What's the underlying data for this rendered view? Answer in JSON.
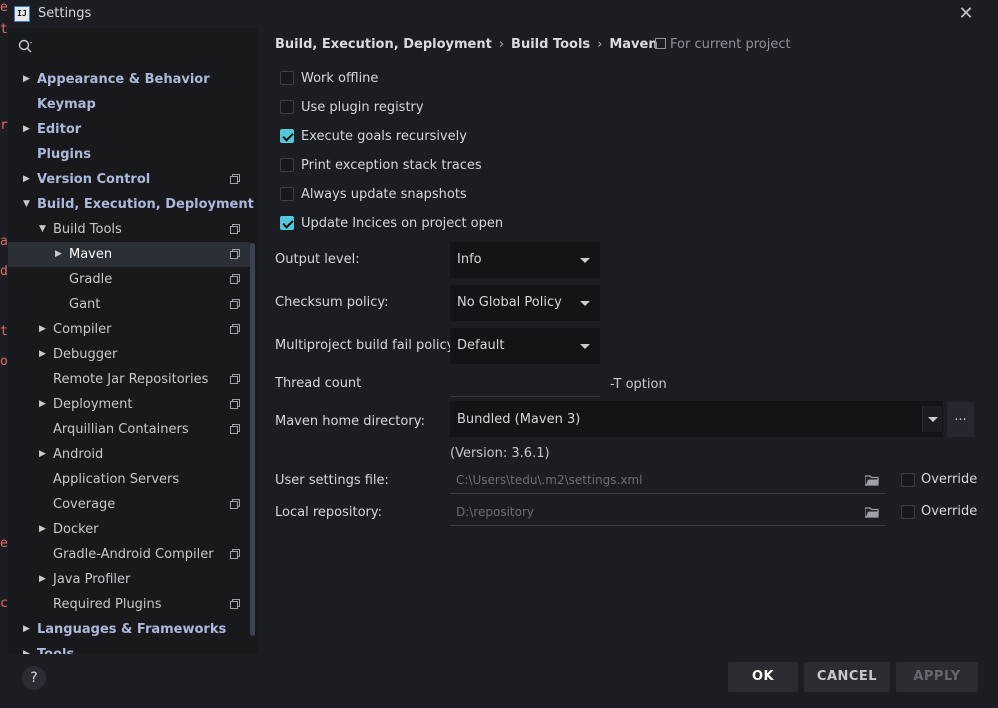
{
  "window": {
    "title": "Settings",
    "logo": "IJ"
  },
  "editor_edge": [
    "e",
    "t",
    "r",
    "a",
    "d",
    "t",
    "o",
    "e",
    "c"
  ],
  "sidebar": {
    "search_placeholder": "",
    "items": [
      {
        "label": "Appearance & Behavior",
        "level": 0,
        "expand": "collapsed",
        "project": false
      },
      {
        "label": "Keymap",
        "level": 0,
        "expand": "none",
        "project": false
      },
      {
        "label": "Editor",
        "level": 0,
        "expand": "collapsed",
        "project": false
      },
      {
        "label": "Plugins",
        "level": 0,
        "expand": "none",
        "project": false
      },
      {
        "label": "Version Control",
        "level": 0,
        "expand": "collapsed",
        "project": true
      },
      {
        "label": "Build, Execution, Deployment",
        "level": 0,
        "expand": "expanded",
        "project": false
      },
      {
        "label": "Build Tools",
        "level": 1,
        "expand": "expanded",
        "project": true
      },
      {
        "label": "Maven",
        "level": 2,
        "expand": "collapsed",
        "project": true,
        "selected": true
      },
      {
        "label": "Gradle",
        "level": 2,
        "expand": "none",
        "project": true
      },
      {
        "label": "Gant",
        "level": 2,
        "expand": "none",
        "project": true
      },
      {
        "label": "Compiler",
        "level": 1,
        "expand": "collapsed",
        "project": true
      },
      {
        "label": "Debugger",
        "level": 1,
        "expand": "collapsed",
        "project": false
      },
      {
        "label": "Remote Jar Repositories",
        "level": 1,
        "expand": "none",
        "project": true
      },
      {
        "label": "Deployment",
        "level": 1,
        "expand": "collapsed",
        "project": true
      },
      {
        "label": "Arquillian Containers",
        "level": 1,
        "expand": "none",
        "project": true
      },
      {
        "label": "Android",
        "level": 1,
        "expand": "collapsed",
        "project": false
      },
      {
        "label": "Application Servers",
        "level": 1,
        "expand": "none",
        "project": false
      },
      {
        "label": "Coverage",
        "level": 1,
        "expand": "none",
        "project": true
      },
      {
        "label": "Docker",
        "level": 1,
        "expand": "collapsed",
        "project": false
      },
      {
        "label": "Gradle-Android Compiler",
        "level": 1,
        "expand": "none",
        "project": true
      },
      {
        "label": "Java Profiler",
        "level": 1,
        "expand": "collapsed",
        "project": false
      },
      {
        "label": "Required Plugins",
        "level": 1,
        "expand": "none",
        "project": true
      },
      {
        "label": "Languages & Frameworks",
        "level": 0,
        "expand": "collapsed",
        "project": false
      },
      {
        "label": "Tools",
        "level": 0,
        "expand": "collapsed",
        "project": false
      }
    ]
  },
  "breadcrumb": {
    "items": [
      "Build, Execution, Deployment",
      "Build Tools",
      "Maven"
    ],
    "separator": "›"
  },
  "scope_note": "For current project",
  "checkboxes": [
    {
      "label": "Work offline",
      "checked": false
    },
    {
      "label": "Use plugin registry",
      "checked": false
    },
    {
      "label": "Execute goals recursively",
      "checked": true
    },
    {
      "label": "Print exception stack traces",
      "checked": false
    },
    {
      "label": "Always update snapshots",
      "checked": false
    },
    {
      "label": "Update Incices on project open",
      "checked": true
    }
  ],
  "output_level": {
    "label": "Output level:",
    "value": "Info"
  },
  "checksum_policy": {
    "label": "Checksum policy:",
    "value": "No Global Policy"
  },
  "fail_policy": {
    "label": "Multiproject build fail policy:",
    "value": "Default"
  },
  "thread_count": {
    "label": "Thread count",
    "value": "",
    "hint": "-T option"
  },
  "maven_home": {
    "label": "Maven home directory:",
    "value": "Bundled (Maven 3)",
    "browse": "...",
    "version": "(Version: 3.6.1)"
  },
  "user_settings": {
    "label": "User settings file:",
    "value": "C:\\Users\\tedu\\.m2\\settings.xml",
    "override_label": "Override",
    "override": false
  },
  "local_repo": {
    "label": "Local repository:",
    "value": "D:\\repository",
    "override_label": "Override",
    "override": false
  },
  "footer": {
    "help": "?",
    "ok": "OK",
    "cancel": "CANCEL",
    "apply": "APPLY"
  },
  "colors": {
    "accent": "#52c8da",
    "background": "#1b1d22",
    "sidebar": "#17191d",
    "selected_row": "#2b2f36"
  }
}
